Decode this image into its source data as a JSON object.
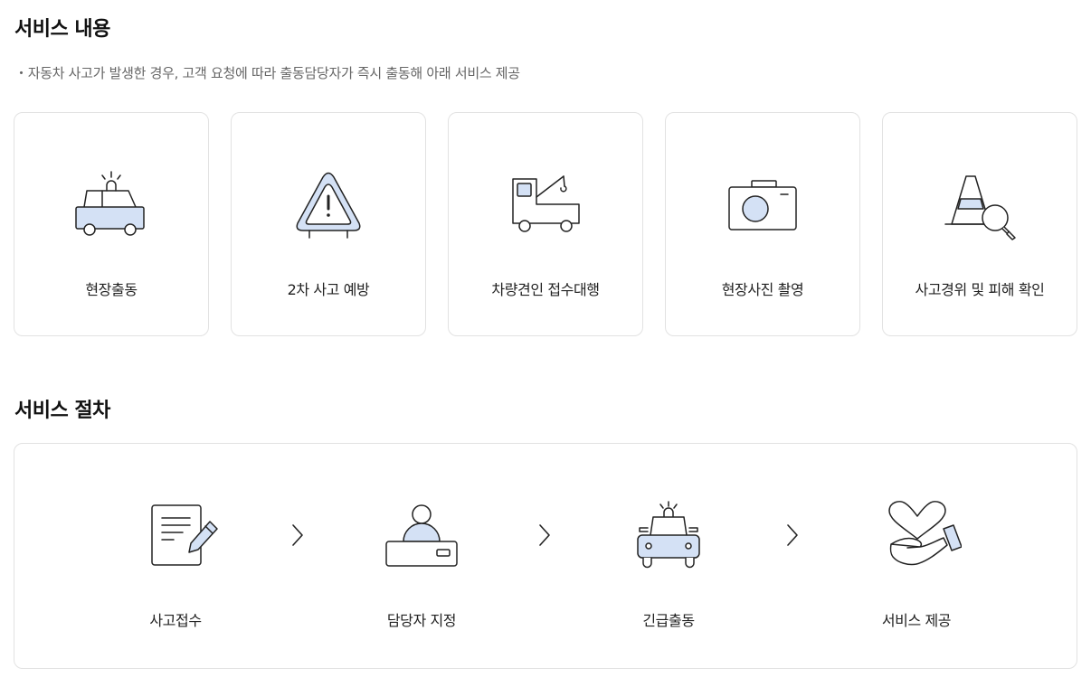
{
  "service_content": {
    "title": "서비스 내용",
    "description": "・자동차 사고가 발생한 경우, 고객 요청에 따라 출동담당자가 즉시 출동해 아래 서비스 제공",
    "cards": [
      {
        "label": "현장출동",
        "icon": "police-car-icon"
      },
      {
        "label": "2차 사고 예방",
        "icon": "warning-triangle-icon"
      },
      {
        "label": "차량견인 접수대행",
        "icon": "tow-truck-icon"
      },
      {
        "label": "현장사진 촬영",
        "icon": "camera-icon"
      },
      {
        "label": "사고경위 및 피해 확인",
        "icon": "traffic-cone-magnifier-icon"
      }
    ]
  },
  "service_procedure": {
    "title": "서비스 절차",
    "steps": [
      {
        "label": "사고접수",
        "icon": "document-pen-icon"
      },
      {
        "label": "담당자 지정",
        "icon": "agent-desk-icon"
      },
      {
        "label": "긴급출동",
        "icon": "emergency-car-icon"
      },
      {
        "label": "서비스 제공",
        "icon": "heart-hand-icon"
      }
    ],
    "separator_icon": "chevron-right-icon"
  },
  "colors": {
    "accent_fill": "#d4e1f5",
    "stroke": "#222222",
    "border": "#e2e2e2",
    "muted_text": "#666666"
  }
}
